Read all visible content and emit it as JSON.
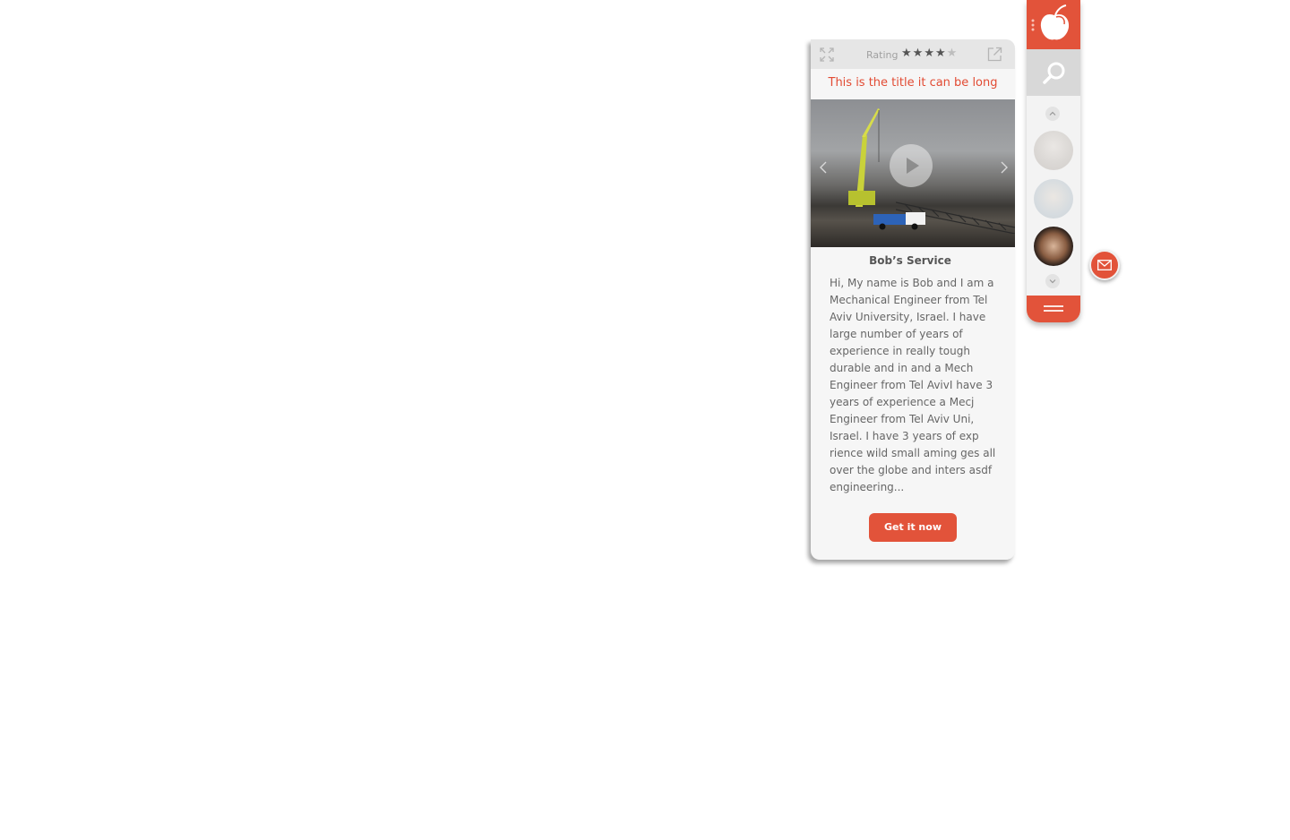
{
  "card": {
    "rating_label": "Rating",
    "rating": {
      "value": 4,
      "max": 5
    },
    "title": "This is the title it can be long",
    "service_name": "Bob’s Service",
    "description": "Hi, My name is Bob and I am a Mechanical Engineer from Tel Aviv University, Israel. I have large number of years of experience in really tough durable and  in  and  a Mech Engineer from Tel AvivI have 3 years of experience a Mecj Engineer from Tel Aviv Uni, Israel. I have 3 years of exp rience wild small aming ges all over the globe and inters asdf engineering...",
    "cta_label": "Get it now",
    "icons": {
      "expand": "expand-icon",
      "external": "external-link-icon",
      "play": "play-icon",
      "prev": "chevron-left-icon",
      "next": "chevron-right-icon"
    }
  },
  "sidebar": {
    "icons": {
      "logo": "apple-logo-icon",
      "search": "search-icon",
      "scroll_up": "chevron-up-icon",
      "scroll_down": "chevron-down-icon",
      "menu": "menu-icon",
      "mail": "mail-icon"
    },
    "avatars": [
      "avatar",
      "avatar",
      "avatar"
    ]
  },
  "colors": {
    "accent": "#e2533a",
    "title": "#e24b33",
    "card_bg": "#f6f6f6",
    "topbar_bg": "#e6e6e6",
    "text": "#666666"
  }
}
